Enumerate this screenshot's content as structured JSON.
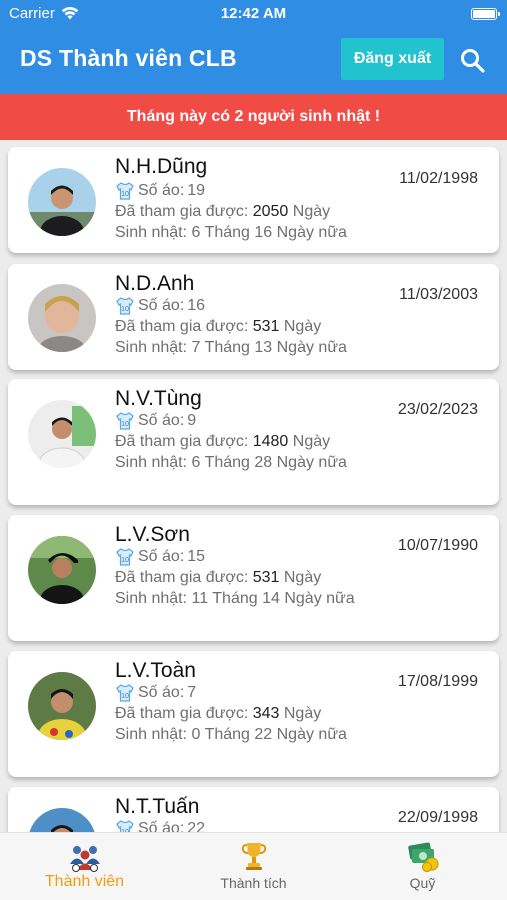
{
  "status_bar": {
    "carrier": "Carrier",
    "time": "12:42 AM"
  },
  "app_bar": {
    "title": "DS Thành viên CLB",
    "logout_label": "Đăng xuất"
  },
  "banner": {
    "text": "Tháng này có 2 người sinh nhật !"
  },
  "labels": {
    "jersey": "Số áo:",
    "joined": "Đã tham gia được:",
    "joined_unit": "Ngày",
    "birthday": "Sinh nhật:"
  },
  "members": [
    {
      "name": "N.H.Dũng",
      "jersey": "19",
      "joined_days": "2050",
      "birthday_line": "6 Tháng 16 Ngày nữa",
      "date": "11/02/1998"
    },
    {
      "name": "N.D.Anh",
      "jersey": "16",
      "joined_days": "531",
      "birthday_line": "7 Tháng 13 Ngày nữa",
      "date": "11/03/2003"
    },
    {
      "name": "N.V.Tùng",
      "jersey": "9",
      "joined_days": "1480",
      "birthday_line": "6 Tháng 28 Ngày nữa",
      "date": "23/02/2023"
    },
    {
      "name": "L.V.Sơn",
      "jersey": "15",
      "joined_days": "531",
      "birthday_line": "11 Tháng 14 Ngày nữa",
      "date": "10/07/1990"
    },
    {
      "name": "L.V.Toàn",
      "jersey": "7",
      "joined_days": "343",
      "birthday_line": "0 Tháng 22 Ngày nữa",
      "date": "17/08/1999"
    },
    {
      "name": "N.T.Tuấn",
      "jersey": "22",
      "joined_days": "",
      "birthday_line": "",
      "date": "22/09/1998"
    }
  ],
  "tabs": [
    {
      "label": "Thành viên",
      "icon": "team-icon",
      "active": true
    },
    {
      "label": "Thành tích",
      "icon": "trophy-icon",
      "active": false
    },
    {
      "label": "Quỹ",
      "icon": "money-icon",
      "active": false
    }
  ],
  "colors": {
    "primary": "#2f8de4",
    "logout": "#21c3cf",
    "banner": "#f14b45",
    "active_tab": "#f39c12"
  }
}
